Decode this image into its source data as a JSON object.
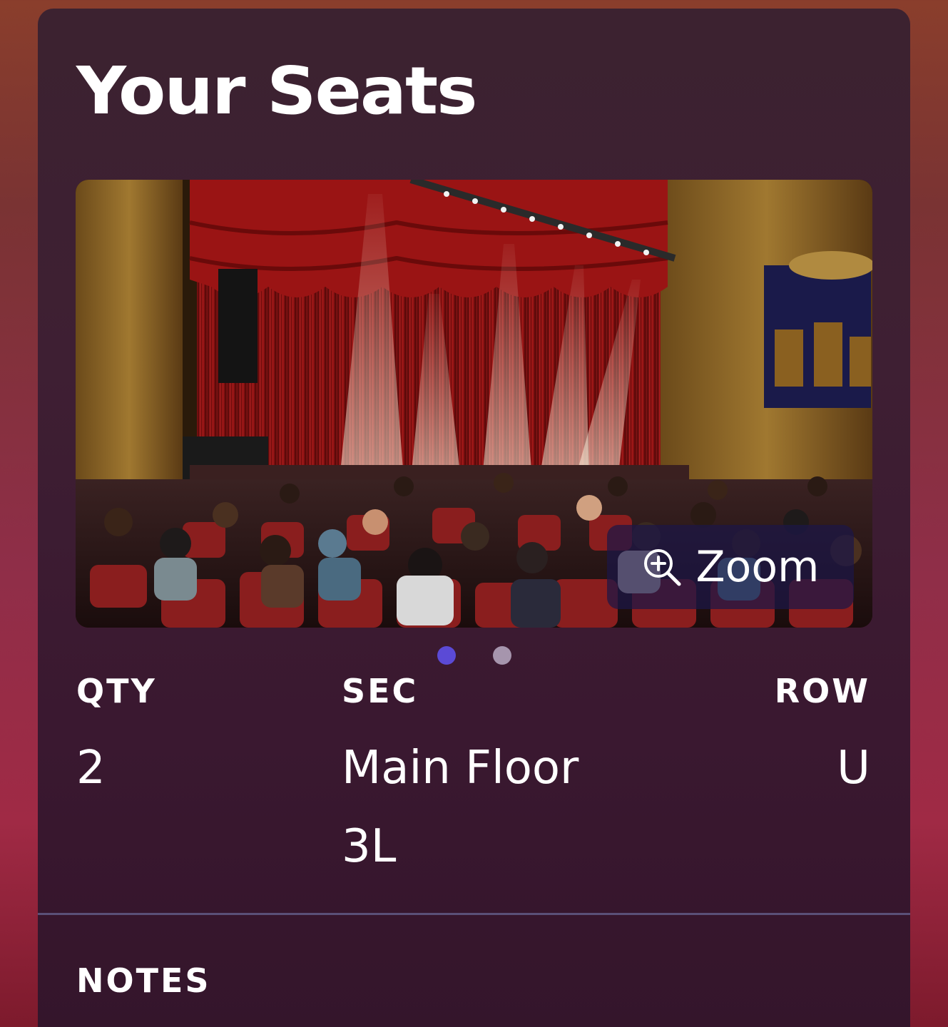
{
  "header": {
    "title": "Your Seats"
  },
  "gallery": {
    "zoom_label": "Zoom",
    "zoom_icon": "zoom-in-icon",
    "page_count": 2,
    "active_page": 1,
    "image_description_icon": "venue-view-image"
  },
  "seat_info": {
    "qty": {
      "label": "QTY",
      "value": "2"
    },
    "sec": {
      "label": "SEC",
      "value_line1": "Main Floor",
      "value_line2": "3L"
    },
    "row": {
      "label": "ROW",
      "value": "U"
    }
  },
  "notes": {
    "label": "NOTES"
  },
  "colors": {
    "card_bg": "#3e1f33",
    "dot_active": "#5b4ad6",
    "dot_inactive": "#a695ad",
    "divider": "#5a5078",
    "zoom_button_bg": "#1c1646"
  }
}
